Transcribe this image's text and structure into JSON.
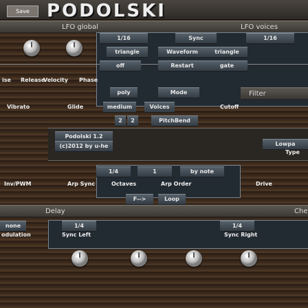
{
  "toolbar": {
    "save_label": "Save",
    "logo": "PODOLSKI"
  },
  "sections": {
    "lfo_global": "LFO global",
    "lfo_voices": "LFO voices",
    "filter": "Filter",
    "delay": "Delay",
    "che": "Che"
  },
  "lfo_global": {
    "sync_left_value": "1/16",
    "sync_label": "Sync",
    "sync_right_value": "1/16",
    "waveform_left": "triangle",
    "waveform_label": "Waveform",
    "waveform_right": "triangle",
    "phase_value": "off",
    "restart_label": "Restart",
    "restart_value": "gate"
  },
  "envelope_labels": [
    "ise",
    "Release",
    "Velocity",
    "Phase"
  ],
  "mode": {
    "value": "poly",
    "label": "Mode"
  },
  "voices": {
    "value": "medium",
    "label": "Voices",
    "arrow_value": "2",
    "arrow_value2": "2",
    "pitchbend_label": "PitchBend"
  },
  "row_labels": {
    "vibrato": "Vibrato",
    "glide": "Glide",
    "cutoff": "Cutoff"
  },
  "info": {
    "line1": "Podolski 1.2",
    "line2": "(c)2012 by u-he"
  },
  "filter_type": {
    "value": "Lowpa",
    "label": "Type"
  },
  "arp": {
    "sync_value": "1/4",
    "octaves_value": "1",
    "order_value": "by note",
    "inv_label": "Inv/PWM",
    "sync_label": "Arp Sync",
    "octaves_label": "Octaves",
    "order_label": "Arp Order",
    "drive_label": "Drive",
    "loop_value": "F-->",
    "loop_label": "Loop"
  },
  "delay_row": {
    "left_value": "none",
    "sync_left_value": "1/4",
    "sync_right_value": "1/4",
    "modulation_label": "odulation",
    "sync_left_label": "Sync Left",
    "sync_right_label": "Sync Right"
  }
}
